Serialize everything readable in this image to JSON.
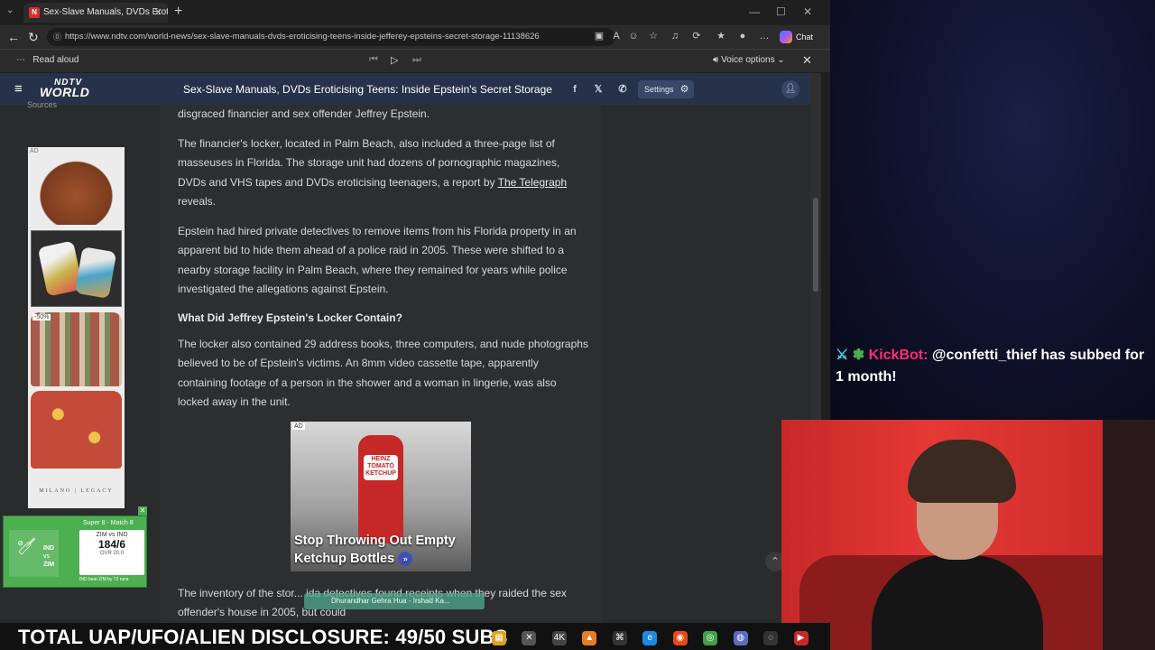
{
  "browser": {
    "tab_title": "Sex-Slave Manuals, DVDs Eroticising Teens: Inside Jefferey Epstein's Secret Storage",
    "tab_favicon": "N",
    "url": "https://www.ndtv.com/world-news/sex-slave-manuals-dvds-eroticising-teens-inside-jefferey-epsteins-secret-storage-11138626",
    "chat_label": "Chat",
    "read_aloud_label": "Read aloud",
    "voice_options_label": "Voice options"
  },
  "site": {
    "logo_top": "NDTV",
    "logo_bottom": "WORLD",
    "header_title": "Sex-Slave Manuals, DVDs Eroticising Teens: Inside Epstein's Secret Storage",
    "settings_label": "Settings",
    "sources_label": "Sources"
  },
  "ad_sidebar": {
    "ad_tag": "AD",
    "sale_badge": "-50%",
    "brand": "MILANO | LEGACY"
  },
  "scorecard": {
    "header": "Super 8 - Match 8",
    "team_left": "IND",
    "vs": "vs",
    "team_right": "ZIM",
    "teams_row": "ZIM  vs  IND",
    "score": "184/6",
    "overs": "OVR 20.0",
    "note": "IND beat ZIM by 72 runs"
  },
  "article": {
    "p0": "disgraced financier and sex offender Jeffrey Epstein.",
    "p1": "The financier's locker, located in Palm Beach, also included a three-page list of masseuses in Florida. The storage unit had dozens of pornographic magazines, DVDs and VHS tapes and DVDs eroticising teenagers, a report by",
    "p1_link": "The Telegraph",
    "p1_end": " reveals.",
    "p2": "Epstein had hired private detectives to remove items from his Florida property in an apparent bid to hide them ahead of a police raid in 2005. These were shifted to a nearby storage facility in Palm Beach, where they remained for years while police investigated the allegations against Epstein.",
    "h1": "What Did Jeffrey Epstein's Locker Contain?",
    "p3": "The locker also contained 29 address books, three computers, and nude photographs believed to be of Epstein's victims. An 8mm video cassette tape, apparently containing footage of a person in the shower and a woman in lingerie, was also locked away in the unit.",
    "ad_tag": "AD",
    "ad_label": "HEINZ TOMATO KETCHUP",
    "ad_caption": "Stop Throwing Out Empty Ketchup Bottles",
    "p4": "The inventory of the stor... ida detectives found receipts when they raided the sex offender's house in 2005, but could"
  },
  "toast": {
    "text": "Dhurandhar   Gehra Hua - Irshad Ka..."
  },
  "stream": {
    "alert_bot": "KickBot:",
    "alert_message": "@confetti_thief has subbed for 1 month!",
    "banner": "TOTAL UAP/UFO/ALIEN DISCLOSURE: 49/50 SUBS"
  },
  "colors": {
    "ndtv_bar": "#26324a",
    "kickbot": "#ff2d6f",
    "scorecard_green": "#4caf50",
    "cam_red": "#e53935"
  }
}
